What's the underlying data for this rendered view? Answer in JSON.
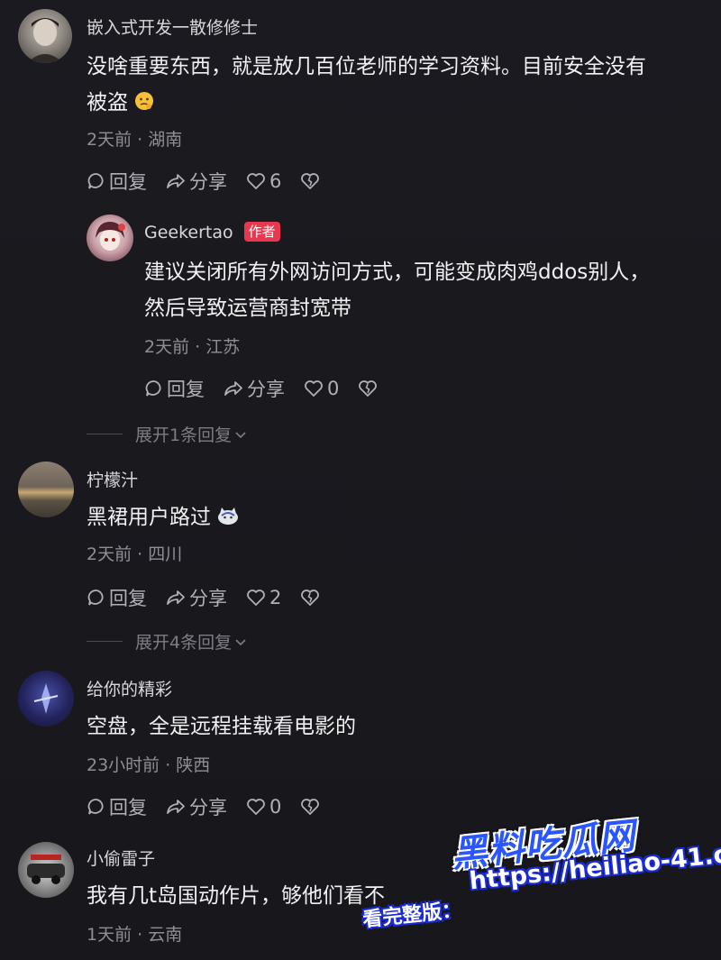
{
  "colors": {
    "background": "#17171c",
    "author_badge": "#e8384f",
    "watermark_blue": "#2a56ff"
  },
  "actions": {
    "reply_label": "回复",
    "share_label": "分享"
  },
  "comments": [
    {
      "username": "嵌入式开发一散修修士",
      "content_line1": "没啥重要东西，就是放几百位老师的学习资料。目前安全没有",
      "content_line2": "被盗",
      "emoji": "thinking-emoji",
      "meta": "2天前 · 湖南",
      "likes": "6",
      "reply": {
        "username": "Geekertao",
        "badge": "作者",
        "content_line1": "建议关闭所有外网访问方式，可能变成肉鸡ddos别人，",
        "content_line2": "然后导致运营商封宽带",
        "meta": "2天前 · 江苏",
        "likes": "0"
      },
      "expand": "展开1条回复"
    },
    {
      "username": "柠檬汁",
      "content": "黑裙用户路过",
      "emoji": "cat-emoji",
      "meta": "2天前 · 四川",
      "likes": "2",
      "expand": "展开4条回复"
    },
    {
      "username": "给你的精彩",
      "content": "空盘，全是远程挂载看电影的",
      "meta": "23小时前 · 陕西",
      "likes": "0"
    },
    {
      "username": "小偷雷子",
      "content": "我有几t岛国动作片，够他们看不",
      "meta": "1天前 · 云南"
    }
  ],
  "watermark": {
    "logo": "黑料吃瓜网",
    "url": "https://heiliao-41.com",
    "prefix": "看完整版："
  }
}
